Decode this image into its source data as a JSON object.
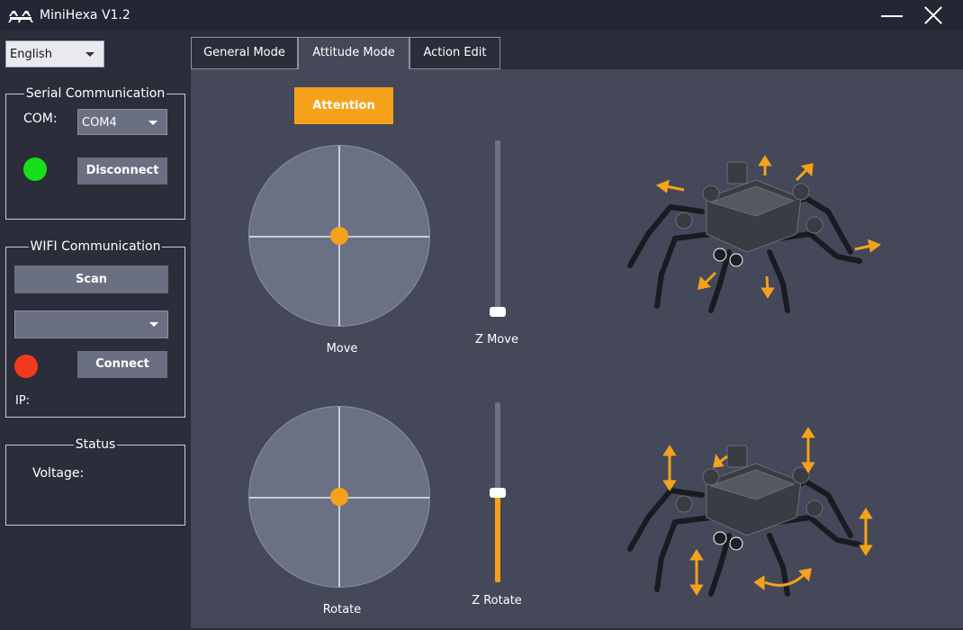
{
  "window": {
    "title": "MiniHexa V1.2"
  },
  "language": {
    "selected": "English"
  },
  "serial": {
    "group_title": "Serial Communication",
    "com_label": "COM:",
    "com_value": "COM4",
    "status_color": "#18e018",
    "button_label": "Disconnect"
  },
  "wifi": {
    "group_title": "WIFI Communication",
    "scan_label": "Scan",
    "network_value": "",
    "status_color": "#f23a1e",
    "button_label": "Connect",
    "ip_label": "IP:"
  },
  "status": {
    "group_title": "Status",
    "voltage_label": "Voltage:"
  },
  "tabs": [
    {
      "label": "General Mode",
      "active": false
    },
    {
      "label": "Attitude Mode",
      "active": true
    },
    {
      "label": "Action Edit",
      "active": false
    }
  ],
  "attitude": {
    "attention_label": "Attention",
    "move": {
      "label": "Move",
      "x": 0,
      "y": 0
    },
    "rotate": {
      "label": "Rotate",
      "x": 0,
      "y": 0
    },
    "z_move": {
      "label": "Z Move",
      "level": 0.0
    },
    "z_rotate": {
      "label": "Z Rotate",
      "level": 0.5
    }
  },
  "colors": {
    "accent": "#f5a21a",
    "background": "#2b2d3a",
    "panel": "#444859",
    "button": "#6a7082"
  },
  "icons": {
    "close": "close-icon",
    "minimize": "minimize-icon",
    "dropdown": "chevron-down-icon"
  }
}
